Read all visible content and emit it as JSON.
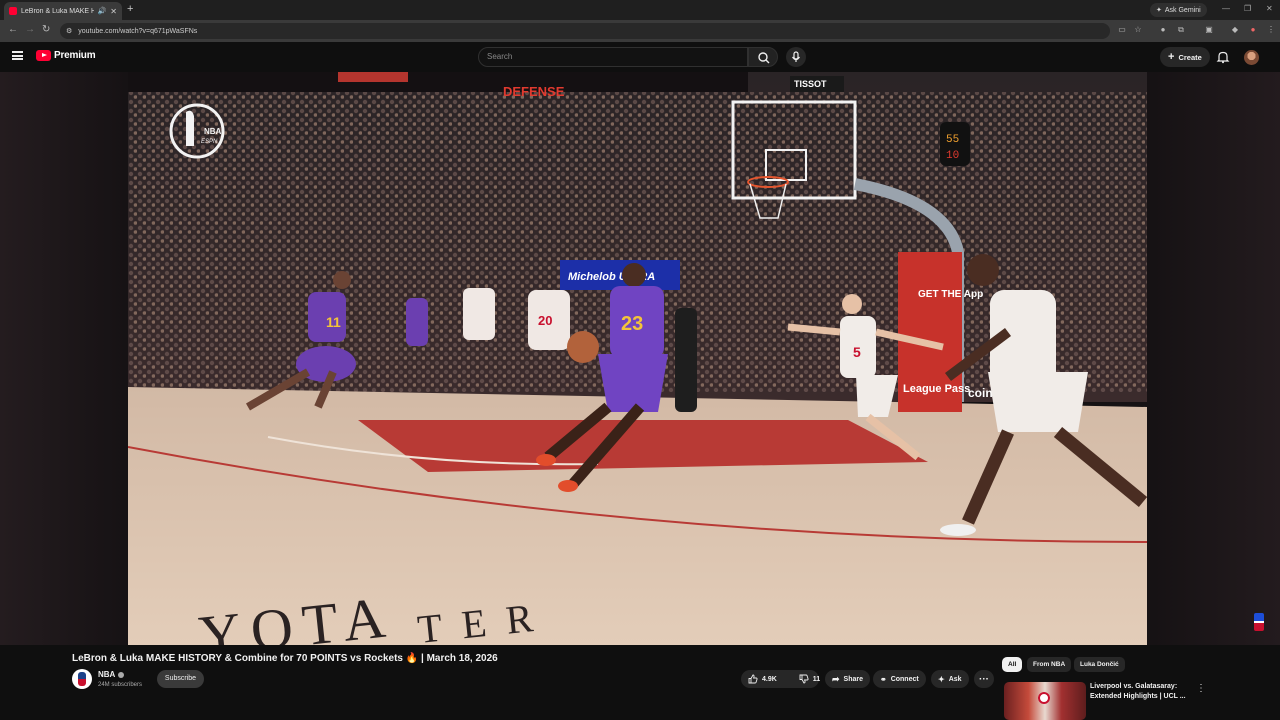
{
  "browser": {
    "tab_title": "LeBron & Luka MAKE HISTO",
    "new_tab": "+",
    "ask_gemini": "Ask Gemini",
    "url": "youtube.com/watch?v=q671pWaSFNs",
    "win_controls": [
      "—",
      "❐",
      "✕"
    ]
  },
  "header": {
    "logo_text": "Premium",
    "search_placeholder": "Search",
    "create_label": "Create"
  },
  "video": {
    "title": "LeBron & Luka MAKE HISTORY & Combine for 70 POINTS vs Rockets 🔥 | March 18, 2026",
    "watermark": "NBA",
    "watermark_sub": "ESPN",
    "jersey_main": "23",
    "jersey_left": "11",
    "jersey_mid": "20",
    "jersey_right": "5",
    "court_text": "YOTA",
    "court_text2": "TER",
    "banner_text": "Michelob ULTRA",
    "scoreboard_top": "DEFENSE",
    "shot_clock_top": "55",
    "shot_clock_bottom": "10",
    "tissot": "TISSOT",
    "league_pass": "League Pass",
    "get_app": "GET THE App",
    "court_ad": "coinb"
  },
  "channel": {
    "name": "NBA",
    "subscribers": "24M subscribers",
    "subscribe_label": "Subscribe"
  },
  "actions": {
    "likes": "4.9K",
    "dislikes": "11",
    "share": "Share",
    "connect": "Connect",
    "ask": "Ask",
    "more": "···"
  },
  "chips": [
    "All",
    "From NBA",
    "Luka Dončić"
  ],
  "recommendation": {
    "title": "Liverpool vs. Galatasaray: Extended Highlights | UCL ...",
    "more": "⋮"
  }
}
